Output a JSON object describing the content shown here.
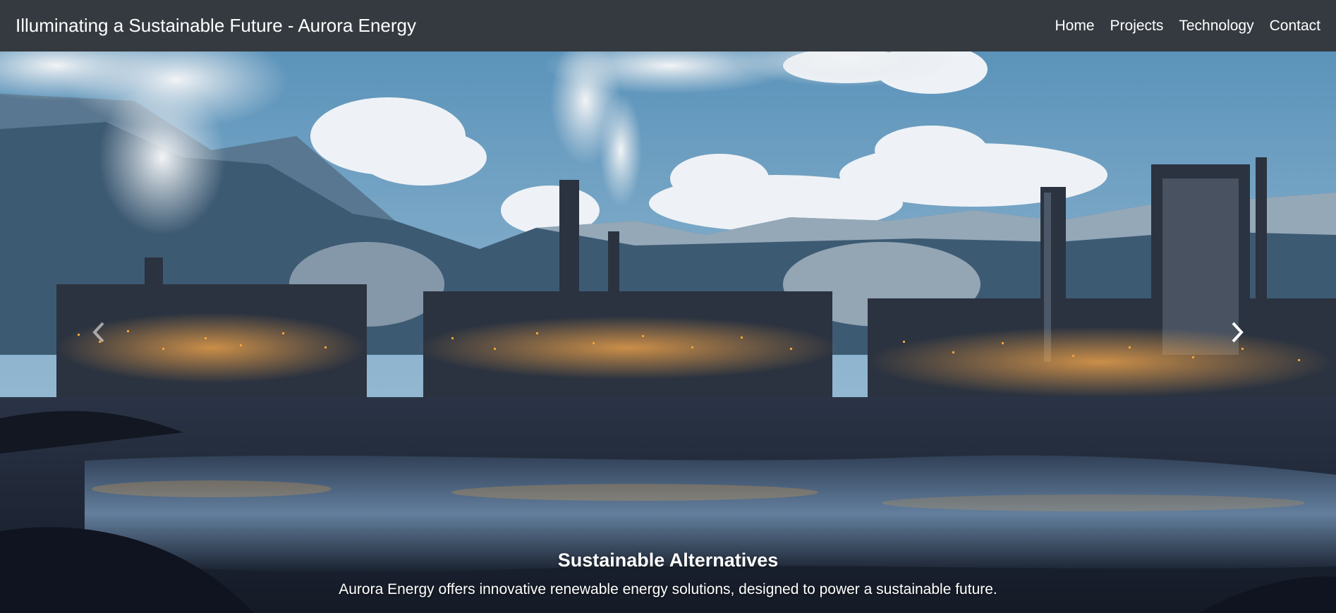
{
  "navbar": {
    "brand": "Illuminating a Sustainable Future - Aurora Energy",
    "links": [
      "Home",
      "Projects",
      "Technology",
      "Contact"
    ]
  },
  "carousel": {
    "slide": {
      "image": "industrial plant with smokestacks in front of snowy mountains reflected in water",
      "caption_title": "Sustainable Alternatives",
      "caption_text": "Aurora Energy offers innovative renewable energy solutions, designed to power a sustainable future."
    },
    "prev_icon": "chevron-left-icon",
    "next_icon": "chevron-right-icon"
  },
  "colors": {
    "navbar_bg": "#343a40",
    "text": "#ffffff",
    "sky": "#4f86ad",
    "mountain": "#3d5a73",
    "ground": "#1c2433",
    "lights": "#f2a43a"
  }
}
